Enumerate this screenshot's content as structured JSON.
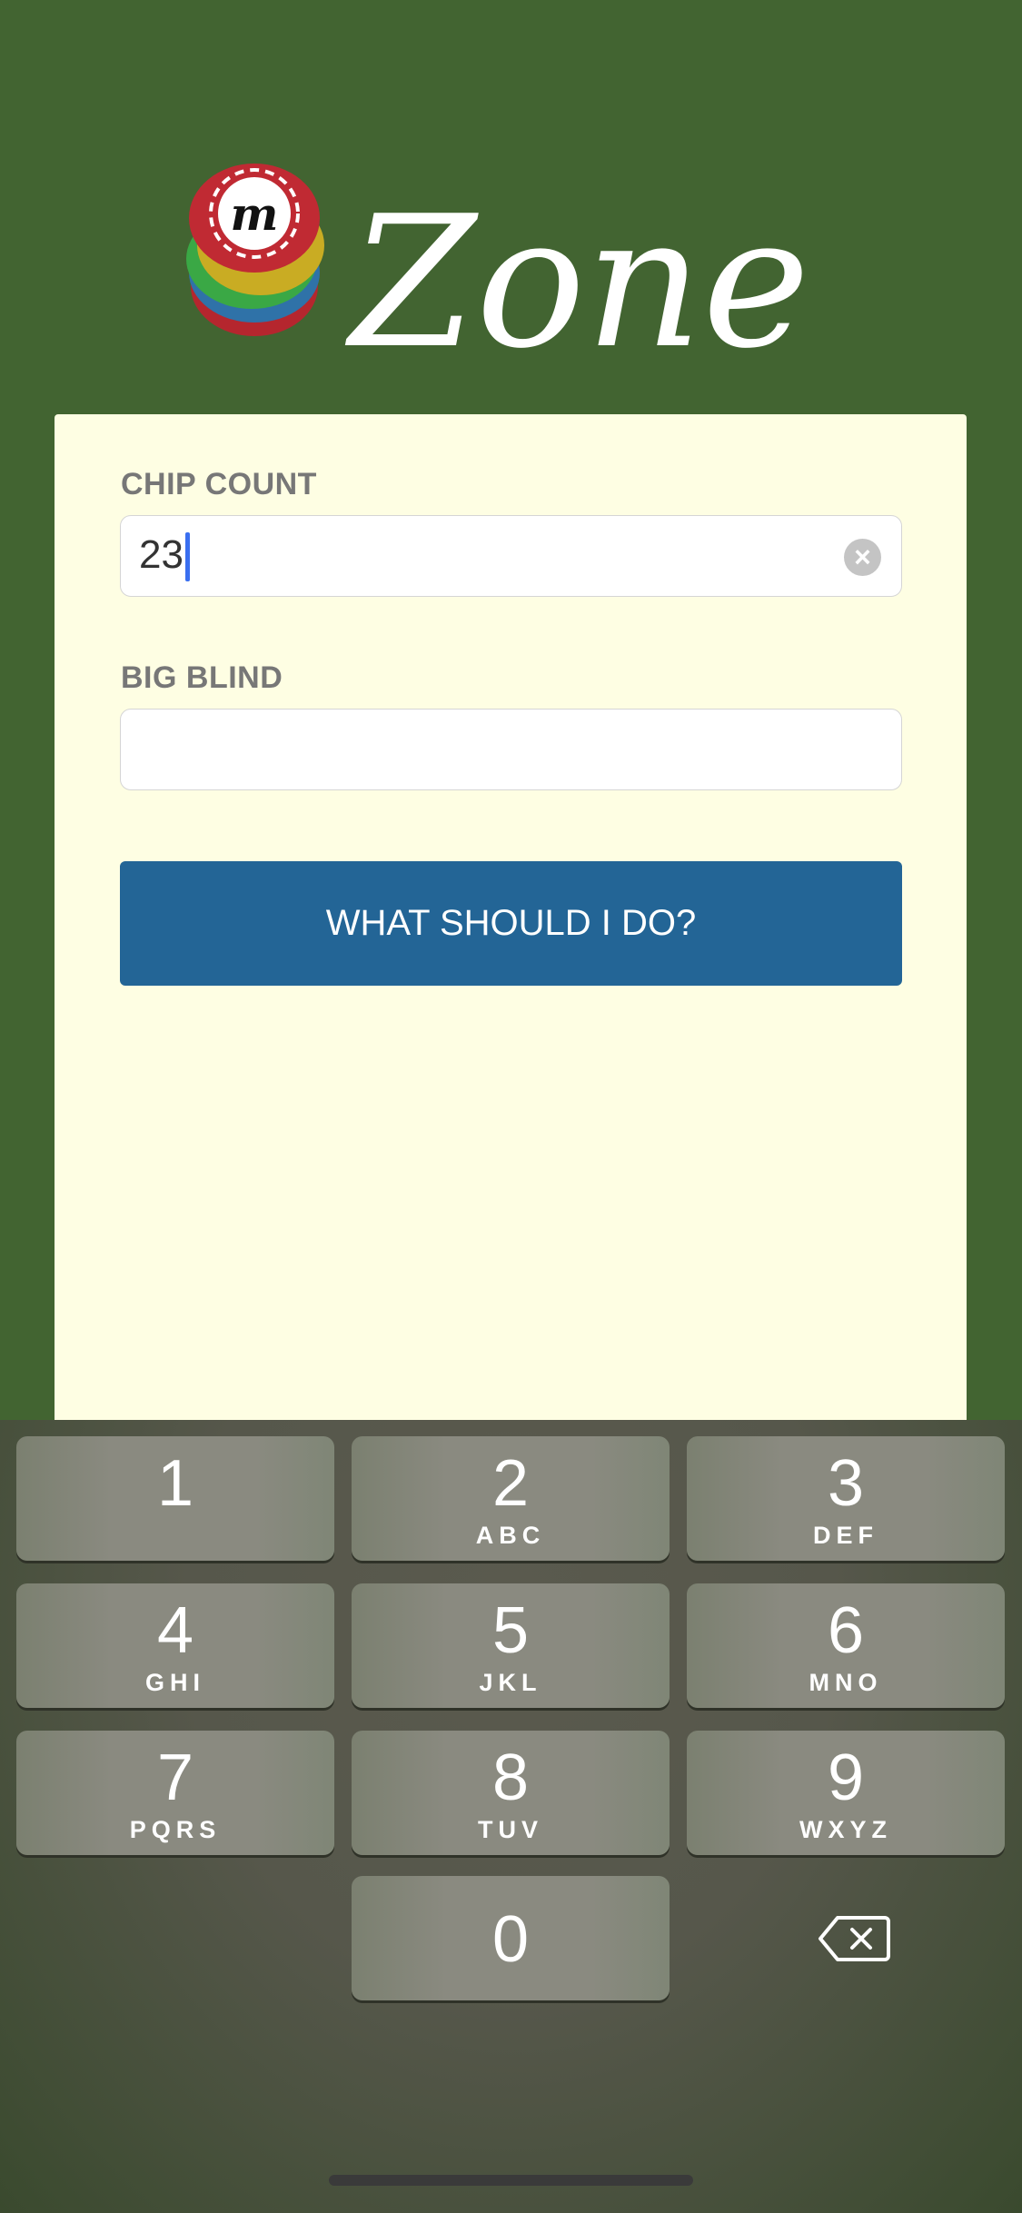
{
  "logo": {
    "text": "Zone",
    "chip_letter": "m"
  },
  "form": {
    "chip_count": {
      "label": "CHIP COUNT",
      "value": "23"
    },
    "big_blind": {
      "label": "BIG BLIND",
      "value": ""
    },
    "submit_label": "WHAT SHOULD I DO?"
  },
  "keyboard": {
    "keys": [
      {
        "d": "1",
        "l": ""
      },
      {
        "d": "2",
        "l": "ABC"
      },
      {
        "d": "3",
        "l": "DEF"
      },
      {
        "d": "4",
        "l": "GHI"
      },
      {
        "d": "5",
        "l": "JKL"
      },
      {
        "d": "6",
        "l": "MNO"
      },
      {
        "d": "7",
        "l": "PQRS"
      },
      {
        "d": "8",
        "l": "TUV"
      },
      {
        "d": "9",
        "l": "WXYZ"
      },
      {
        "d": "0",
        "l": ""
      }
    ]
  },
  "colors": {
    "background": "#426431",
    "card": "#fefee3",
    "button": "#236596"
  }
}
